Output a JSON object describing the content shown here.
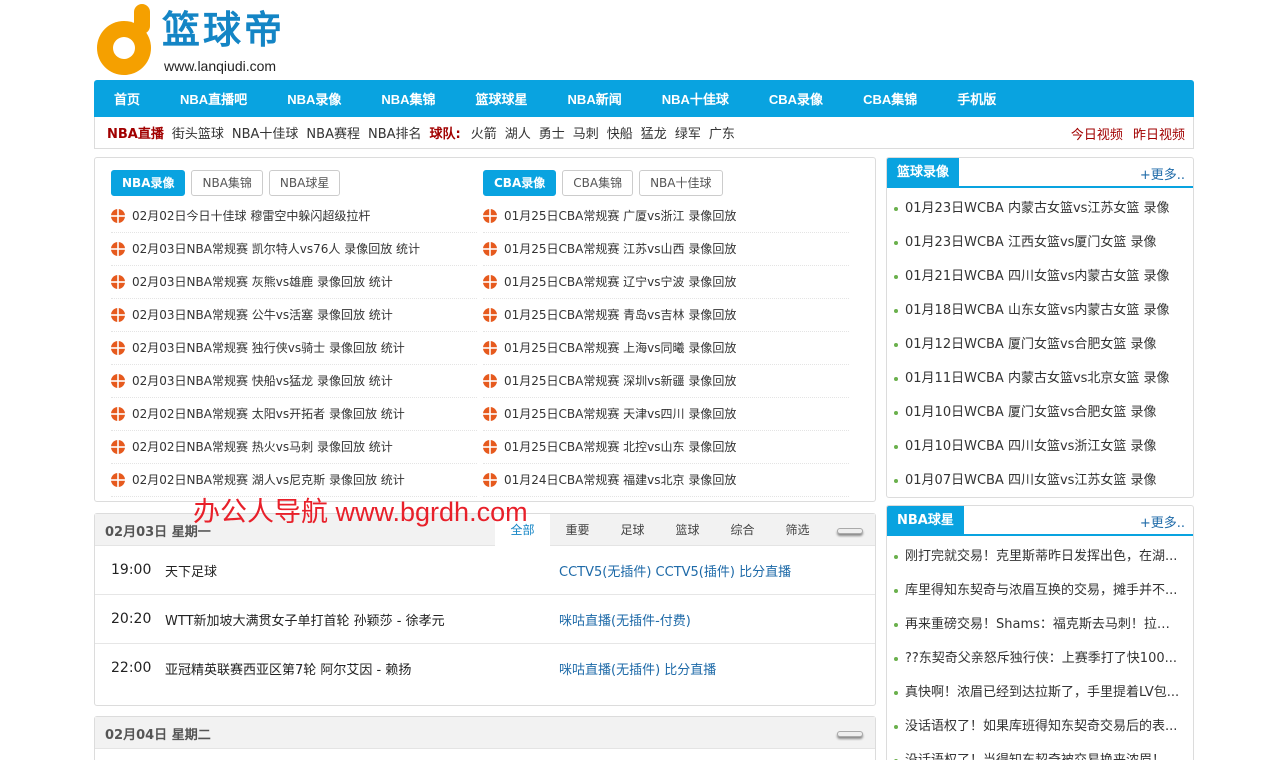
{
  "brand": {
    "title": "篮球帝",
    "url": "www.lanqiudi.com"
  },
  "nav": [
    "首页",
    "NBA直播吧",
    "NBA录像",
    "NBA集锦",
    "篮球球星",
    "NBA新闻",
    "NBA十佳球",
    "CBA录像",
    "CBA集锦",
    "手机版"
  ],
  "subnav": {
    "primary": "NBA直播",
    "items": [
      "街头篮球",
      "NBA十佳球",
      "NBA赛程",
      "NBA排名"
    ],
    "teams_label": "球队:",
    "teams": [
      "火箭",
      "湖人",
      "勇士",
      "马刺",
      "快船",
      "猛龙",
      "绿军",
      "广东"
    ],
    "right": [
      "今日视频",
      "昨日视频"
    ]
  },
  "left_col": {
    "tabs": [
      "NBA录像",
      "NBA集锦",
      "NBA球星"
    ],
    "items": [
      "02月02日今日十佳球 穆雷空中躲闪超级拉杆",
      "02月03日NBA常规赛 凯尔特人vs76人 录像回放 统计",
      "02月03日NBA常规赛 灰熊vs雄鹿 录像回放 统计",
      "02月03日NBA常规赛 公牛vs活塞 录像回放 统计",
      "02月03日NBA常规赛 独行侠vs骑士 录像回放 统计",
      "02月03日NBA常规赛 快船vs猛龙 录像回放 统计",
      "02月02日NBA常规赛 太阳vs开拓者 录像回放 统计",
      "02月02日NBA常规赛 热火vs马刺 录像回放 统计",
      "02月02日NBA常规赛 湖人vs尼克斯 录像回放 统计"
    ]
  },
  "right_col": {
    "tabs": [
      "CBA录像",
      "CBA集锦",
      "NBA十佳球"
    ],
    "items": [
      "01月25日CBA常规赛 广厦vs浙江 录像回放",
      "01月25日CBA常规赛 江苏vs山西 录像回放",
      "01月25日CBA常规赛 辽宁vs宁波 录像回放",
      "01月25日CBA常规赛 青岛vs吉林 录像回放",
      "01月25日CBA常规赛 上海vs同曦 录像回放",
      "01月25日CBA常规赛 深圳vs新疆 录像回放",
      "01月25日CBA常规赛 天津vs四川 录像回放",
      "01月25日CBA常规赛 北控vs山东 录像回放",
      "01月24日CBA常规赛 福建vs北京 录像回放"
    ]
  },
  "watermark": "办公人导航  www.bgrdh.com",
  "schedule": [
    {
      "date": "02月03日  星期一",
      "tabs": [
        "全部",
        "重要",
        "足球",
        "篮球",
        "综合",
        "筛选"
      ],
      "matches": [
        {
          "time": "19:00",
          "name": "天下足球",
          "links": "CCTV5(无插件) CCTV5(插件) 比分直播"
        },
        {
          "time": "20:20",
          "name": "WTT新加坡大满贯女子单打首轮  孙颖莎 - 徐孝元",
          "links": "咪咕直播(无插件-付费)"
        },
        {
          "time": "22:00",
          "name": "亚冠精英联赛西亚区第7轮  阿尔艾因 - 赖扬",
          "links": "咪咕直播(无插件) 比分直播"
        }
      ]
    },
    {
      "date": "02月04日  星期二"
    }
  ],
  "sidebar": [
    {
      "title": "篮球录像",
      "more": "+更多..",
      "items": [
        "01月23日WCBA 内蒙古女篮vs江苏女篮 录像",
        "01月23日WCBA 江西女篮vs厦门女篮 录像",
        "01月21日WCBA 四川女篮vs内蒙古女篮 录像",
        "01月18日WCBA 山东女篮vs内蒙古女篮 录像",
        "01月12日WCBA 厦门女篮vs合肥女篮 录像",
        "01月11日WCBA 内蒙古女篮vs北京女篮 录像",
        "01月10日WCBA 厦门女篮vs合肥女篮 录像",
        "01月10日WCBA 四川女篮vs浙江女篮 录像",
        "01月07日WCBA 四川女篮vs江苏女篮 录像"
      ]
    },
    {
      "title": "NBA球星",
      "more": "+更多..",
      "items": [
        "刚打完就交易！克里斯蒂昨日发挥出色，在湖...",
        "库里得知东契奇与浓眉互换的交易，摊手并不...",
        "再来重磅交易！Shams：福克斯去马刺！拉文...",
        "??东契奇父亲怒斥独行侠：上赛季打了快100...",
        "真快啊！浓眉已经到达拉斯了，手里提着LV包...",
        "没话语权了！如果库班得知东契奇交易后的表...",
        "没话语权了！当得知东契奇被交易换来浓眉！..."
      ]
    }
  ],
  "colors": {
    "accent": "#09a3e0",
    "brand": "#1485c5",
    "red": "#a10000",
    "link": "#1e6aa8"
  }
}
